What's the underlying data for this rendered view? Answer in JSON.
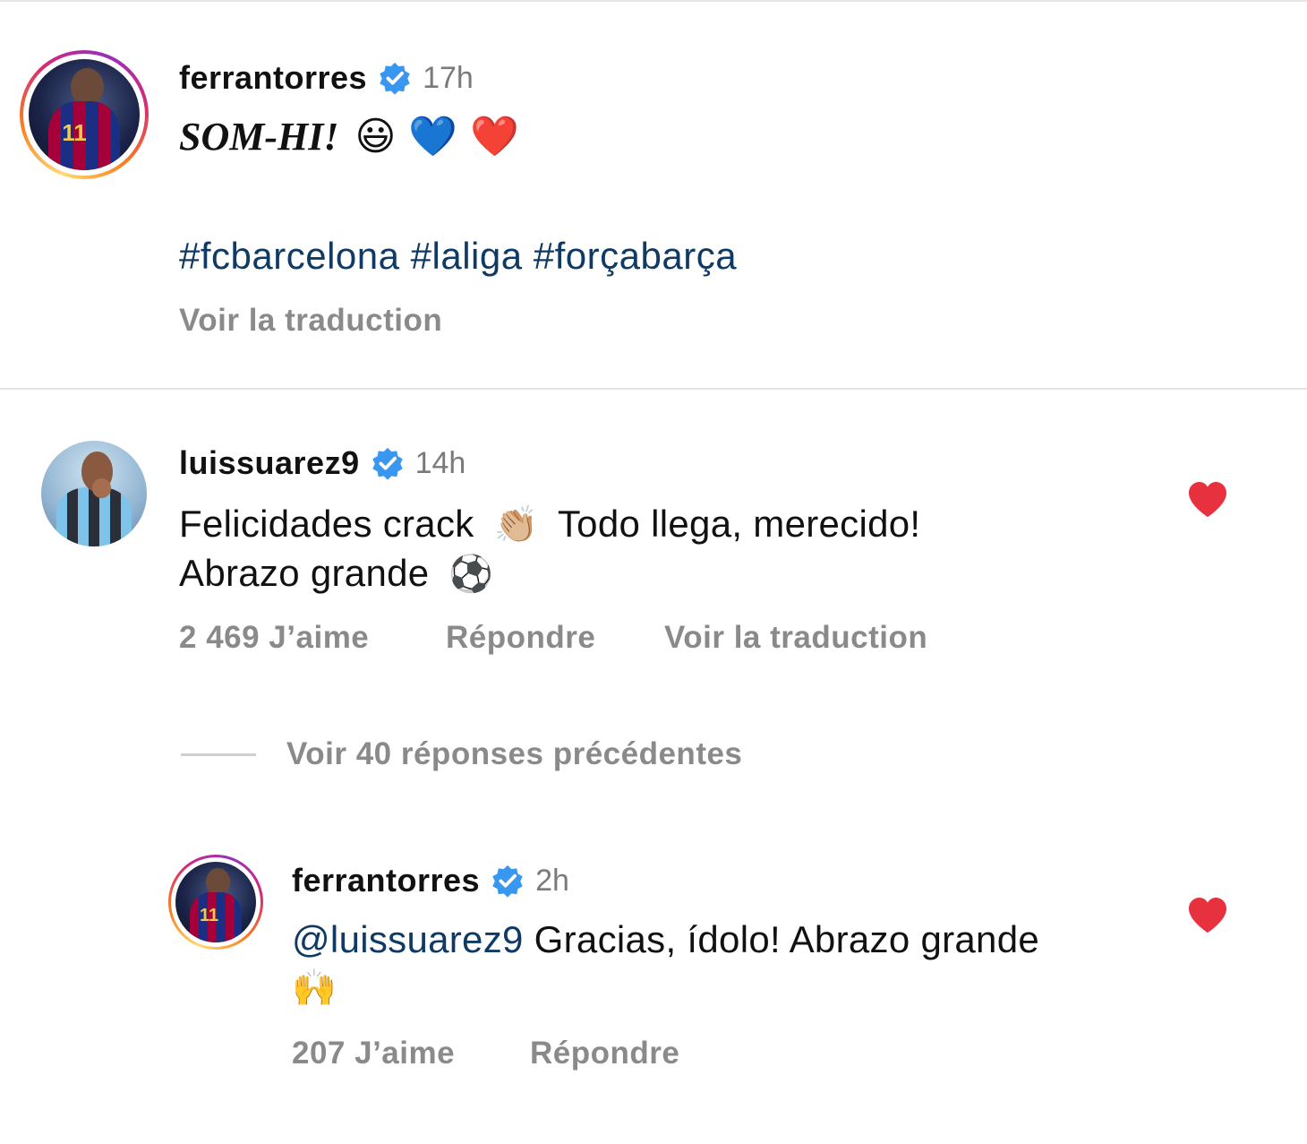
{
  "post": {
    "username": "ferrantorres",
    "time": "17h",
    "caption_title": "SOM-HI!",
    "caption_emojis": "😃 💙 ❤️",
    "hashtags": "#fcbarcelona #laliga #forçabarça",
    "translate_label": "Voir la traduction"
  },
  "comment": {
    "username": "luissuarez9",
    "time": "14h",
    "line1_a": "Felicidades crack",
    "line1_emoji": "👏🏼",
    "line1_b": "Todo llega, merecido!",
    "line2": "Abrazo grande",
    "line2_emoji": "⚽",
    "likes": "2 469 J’aime",
    "reply_label": "Répondre",
    "translate_label": "Voir la traduction"
  },
  "view_replies_label": "Voir 40 réponses précédentes",
  "reply": {
    "username": "ferrantorres",
    "time": "2h",
    "mention": "@luissuarez9",
    "text": "Gracias, ídolo! Abrazo grande",
    "emoji": "🙌",
    "likes": "207 J’aime",
    "reply_label": "Répondre"
  },
  "colors": {
    "verified": "#3897f0",
    "heart": "#e8313f",
    "hashtag": "#0f3a66",
    "muted": "#8a8a8a"
  },
  "icons": {
    "verified": "verified-badge-icon",
    "like": "heart-icon"
  }
}
